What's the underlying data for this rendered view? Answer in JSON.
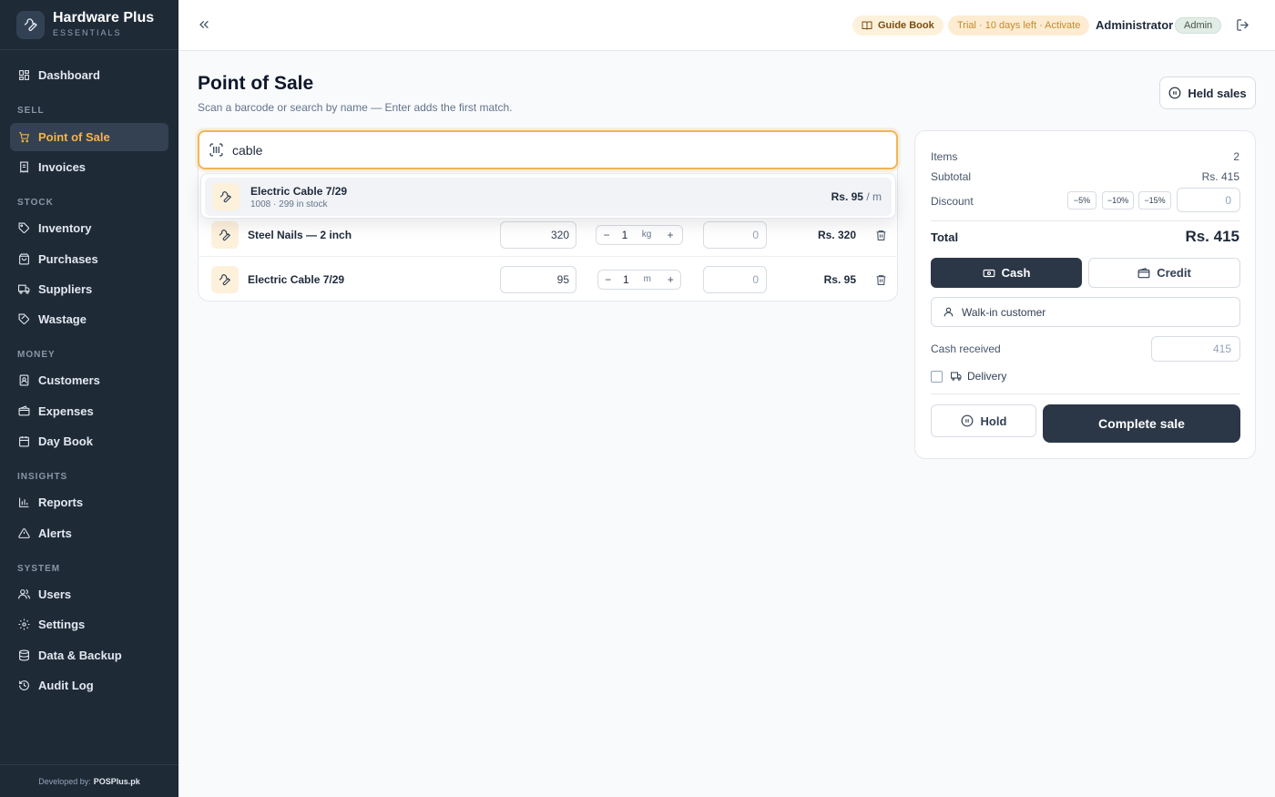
{
  "brand": {
    "name": "Hardware Plus",
    "sub": "ESSENTIALS"
  },
  "nav": {
    "dashboard": "Dashboard",
    "section_sell": "SELL",
    "pos": "Point of Sale",
    "invoices": "Invoices",
    "section_stock": "STOCK",
    "inventory": "Inventory",
    "purchases": "Purchases",
    "suppliers": "Suppliers",
    "wastage": "Wastage",
    "section_money": "MONEY",
    "customers": "Customers",
    "expenses": "Expenses",
    "daybook": "Day Book",
    "section_insights": "INSIGHTS",
    "reports": "Reports",
    "alerts": "Alerts",
    "section_system": "SYSTEM",
    "users": "Users",
    "settings": "Settings",
    "backup": "Data & Backup",
    "audit": "Audit Log",
    "active": "pos"
  },
  "footer": {
    "prefix": "Developed by:",
    "brand": "POSPlus.pk"
  },
  "topbar": {
    "guide": "Guide Book",
    "trial": "Trial · 10 days left · Activate",
    "user": "Administrator",
    "role": "Admin"
  },
  "page": {
    "title": "Point of Sale",
    "subtitle": "Scan a barcode or search by name — Enter adds the first match.",
    "held_sales": "Held sales"
  },
  "search": {
    "value": "cable"
  },
  "suggestion": {
    "name": "Electric Cable 7/29",
    "meta": "1008 · 299 in stock",
    "price": "Rs. 95",
    "unit": "/ m"
  },
  "cart": [
    {
      "name": "Steel Nails — 2 inch",
      "price": "320",
      "qty": "1",
      "unit": "kg",
      "discount": "0",
      "total": "Rs. 320"
    },
    {
      "name": "Electric Cable 7/29",
      "price": "95",
      "qty": "1",
      "unit": "m",
      "discount": "0",
      "total": "Rs. 95"
    }
  ],
  "summary": {
    "items_label": "Items",
    "items": "2",
    "subtotal_label": "Subtotal",
    "subtotal": "Rs. 415",
    "discount_label": "Discount",
    "chips": [
      "−5%",
      "−10%",
      "−15%"
    ],
    "discount_placeholder": "0",
    "total_label": "Total",
    "total": "Rs. 415",
    "cash": "Cash",
    "credit": "Credit",
    "customer": "Walk-in customer",
    "cash_received_label": "Cash received",
    "cash_received_placeholder": "415",
    "delivery": "Delivery",
    "hold": "Hold",
    "complete": "Complete sale"
  },
  "colors": {
    "sidebar": "#1f2a37",
    "accent": "#f5b34a",
    "primary_button": "#2b3747"
  }
}
